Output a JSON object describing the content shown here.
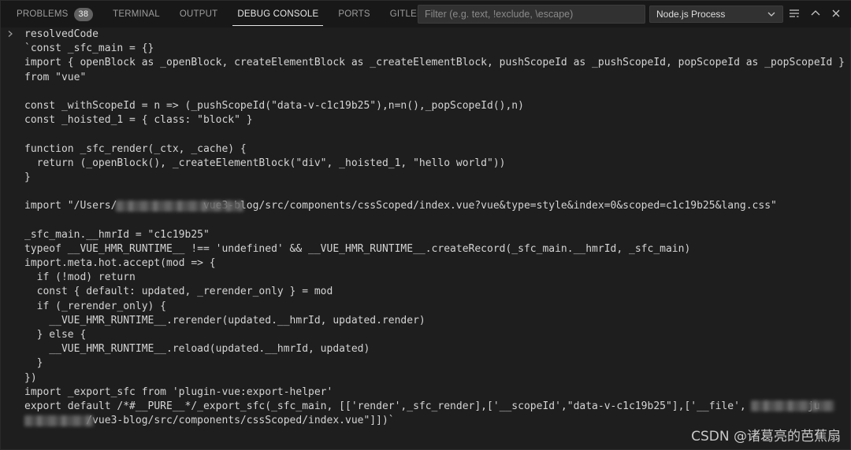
{
  "tabs": [
    {
      "label": "PROBLEMS",
      "badge": "38"
    },
    {
      "label": "TERMINAL"
    },
    {
      "label": "OUTPUT"
    },
    {
      "label": "DEBUG CONSOLE"
    },
    {
      "label": "PORTS"
    },
    {
      "label": "GITLENS"
    }
  ],
  "active_tab": "DEBUG CONSOLE",
  "filter": {
    "placeholder": "Filter (e.g. text, !exclude, \\escape)",
    "value": ""
  },
  "process_select": {
    "value": "Node.js Process"
  },
  "icons": [
    "chevron-right-icon",
    "chevron-down-icon",
    "word-wrap-icon",
    "chevron-up-icon",
    "close-icon"
  ],
  "console_lines": [
    "resolvedCode",
    "`const _sfc_main = {}",
    "import { openBlock as _openBlock, createElementBlock as _createElementBlock, pushScopeId as _pushScopeId, popScopeId as _popScopeId }",
    "from \"vue\"",
    "",
    "const _withScopeId = n => (_pushScopeId(\"data-v-c1c19b25\"),n=n(),_popScopeId(),n)",
    "const _hoisted_1 = { class: \"block\" }",
    "",
    "function _sfc_render(_ctx, _cache) {",
    "  return (_openBlock(), _createElementBlock(\"div\", _hoisted_1, \"hello world\"))",
    "}",
    "",
    "import \"/Users/              vue3-blog/src/components/cssScoped/index.vue?vue&type=style&index=0&scoped=c1c19b25&lang.css\"",
    "",
    "_sfc_main.__hmrId = \"c1c19b25\"",
    "typeof __VUE_HMR_RUNTIME__ !== 'undefined' && __VUE_HMR_RUNTIME__.createRecord(_sfc_main.__hmrId, _sfc_main)",
    "import.meta.hot.accept(mod => {",
    "  if (!mod) return",
    "  const { default: updated, _rerender_only } = mod",
    "  if (_rerender_only) {",
    "    __VUE_HMR_RUNTIME__.rerender(updated.__hmrId, updated.render)",
    "  } else {",
    "    __VUE_HMR_RUNTIME__.reload(updated.__hmrId, updated)",
    "  }",
    "})",
    "import _export_sfc from 'plugin-vue:export-helper'",
    "export default /*#__PURE__*/_export_sfc(_sfc_main, [['render',_sfc_render],['__scopeId',\"data-v-c1c19b25\"],['__file',          ju",
    "          /vue3-blog/src/components/cssScoped/index.vue\"]])`"
  ],
  "watermark": "CSDN @诸葛亮的芭蕉扇",
  "colors": {
    "panel_bg": "#1e1e1e",
    "header_bg": "#181818",
    "badge_bg": "#616161",
    "text": "#d4d4d4"
  }
}
